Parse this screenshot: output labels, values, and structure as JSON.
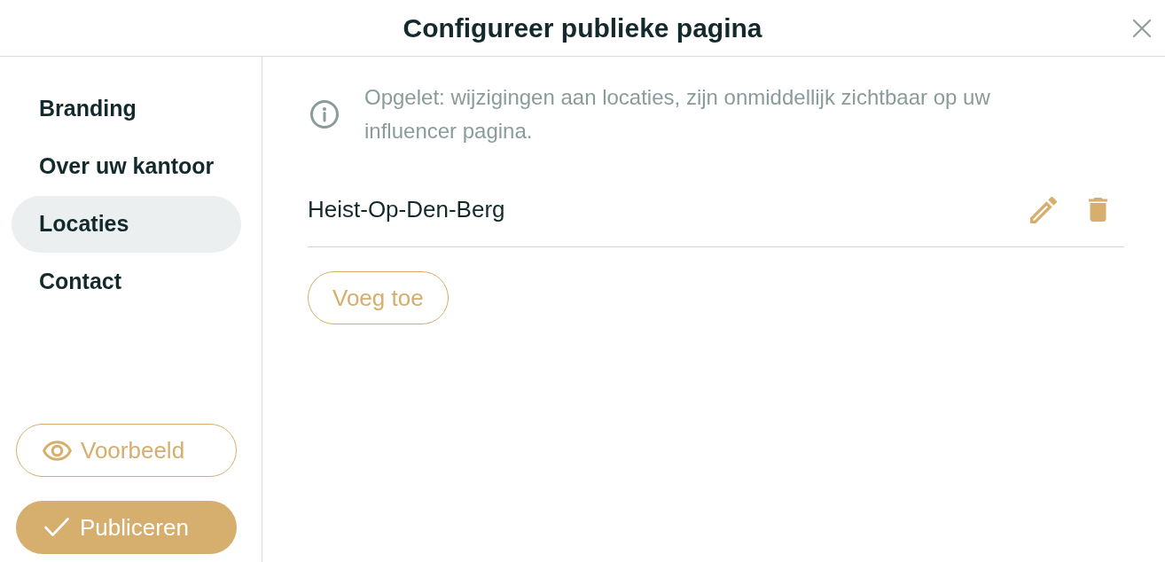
{
  "window": {
    "title": "Configureer publieke pagina"
  },
  "sidebar": {
    "items": [
      {
        "label": "Branding",
        "selected": false
      },
      {
        "label": "Over uw kantoor",
        "selected": false
      },
      {
        "label": "Locaties",
        "selected": true
      },
      {
        "label": "Contact",
        "selected": false
      }
    ],
    "actions": [
      {
        "kind": "preview",
        "label": "Voorbeeld"
      },
      {
        "kind": "publish",
        "label": "Publiceren"
      }
    ]
  },
  "notice": {
    "text": "Opgelet: wijzigingen aan locaties, zijn onmiddellijk zichtbaar op uw influencer pagina."
  },
  "locations": [
    {
      "name": "Heist-Op-Den-Berg"
    }
  ],
  "add_button": {
    "label": "Voeg toe"
  }
}
